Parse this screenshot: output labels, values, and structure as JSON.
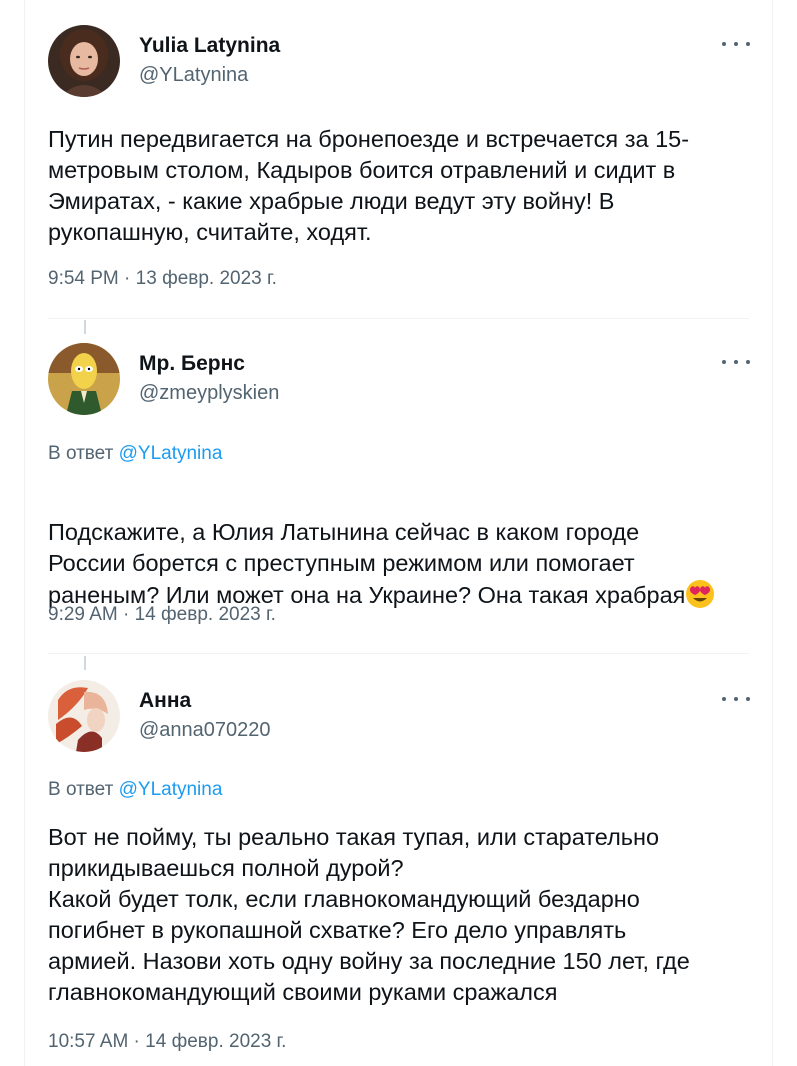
{
  "tweets": [
    {
      "author_name": "Yulia Latynina",
      "author_handle": "@YLatynina",
      "text": "Путин передвигается на бронепоезде и встречается за 15-\nметровым столом, Кадыров боится отравлений и сидит в\nЭмиратах,  - какие храбрые люди ведут эту войну! В\nрукопашную, считайте, ходят.",
      "time": "9:54 PM",
      "date": "13 февр. 2023 г.",
      "more_icon": "more-horizontal-icon"
    },
    {
      "author_name": "Мр. Бернс",
      "author_handle": "@zmeyplyskien",
      "reply_prefix": "В ответ",
      "reply_handle": "@YLatynina",
      "text": "Подскажите, а Юлия Латынина сейчас в каком городе\nРоссии борется с преступным режимом или помогает\nраненым? Или может она на Украине? Она такая храбрая",
      "emoji": "heart-eyes-emoji",
      "time": "9:29 AM",
      "date": "14 февр. 2023 г.",
      "more_icon": "more-horizontal-icon"
    },
    {
      "author_name": "Анна",
      "author_handle": "@anna070220",
      "reply_prefix": "В ответ",
      "reply_handle": "@YLatynina",
      "text": "Вот не пойму, ты реально такая тупая, или старательно\nприкидываешься полной дурой?\nКакой будет толк, если главнокомандующий бездарно\nпогибнет в рукопашной схватке? Его дело управлять\nармией. Назови хоть одну войну за последние 150 лет, где\nглавнокомандующий своими руками сражался",
      "time": "10:57 AM",
      "date": "14 февр. 2023 г.",
      "more_icon": "more-horizontal-icon"
    }
  ],
  "separator": " · ",
  "colors": {
    "text": "#0f1419",
    "secondary": "#536471",
    "link": "#1d9bf0",
    "divider": "#eff3f4"
  }
}
